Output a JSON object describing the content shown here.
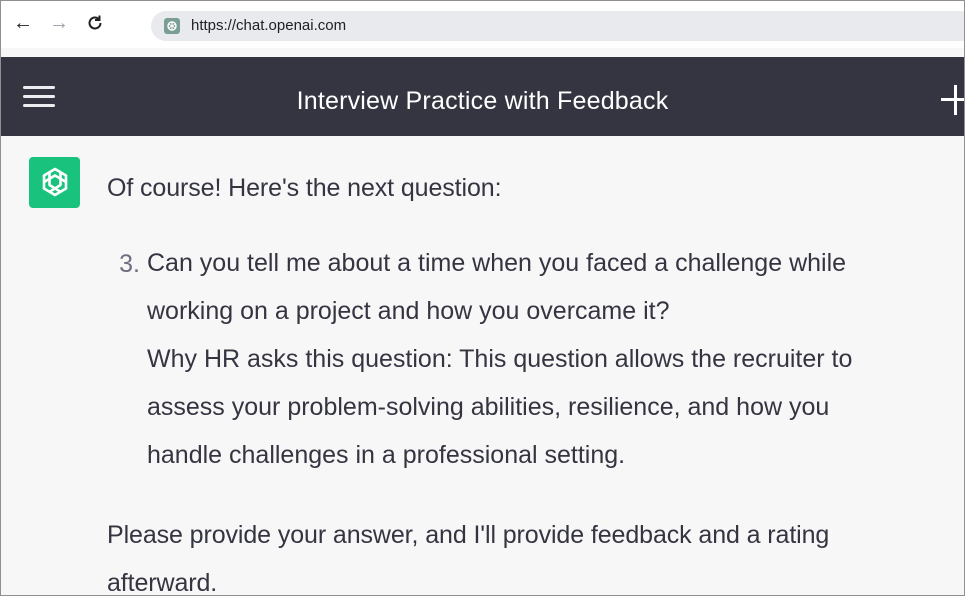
{
  "browser": {
    "url": "https://chat.openai.com",
    "back_icon": "←",
    "forward_icon": "→",
    "reload_icon": "C"
  },
  "header": {
    "title": "Interview Practice with Feedback"
  },
  "message": {
    "intro": "Of course! Here's the next question:",
    "question": {
      "number": "3.",
      "lines": [
        "Can you tell me about a time when you faced a challenge while",
        "working on a project and how you overcame it?",
        "Why HR asks this question: This question allows the recruiter to",
        "assess your problem-solving abilities, resilience, and how you",
        "handle challenges in a professional setting."
      ]
    },
    "outro_lines": [
      "Please provide your answer, and I'll provide feedback and a rating",
      "afterward."
    ]
  },
  "colors": {
    "header_bg": "#343541",
    "avatar_bg": "#19c37d",
    "text": "#343541",
    "page_bg": "#f7f7f8"
  },
  "icons": {
    "menu": "hamburger-menu-icon",
    "new_chat": "plus-icon",
    "assistant": "openai-logo-icon"
  }
}
